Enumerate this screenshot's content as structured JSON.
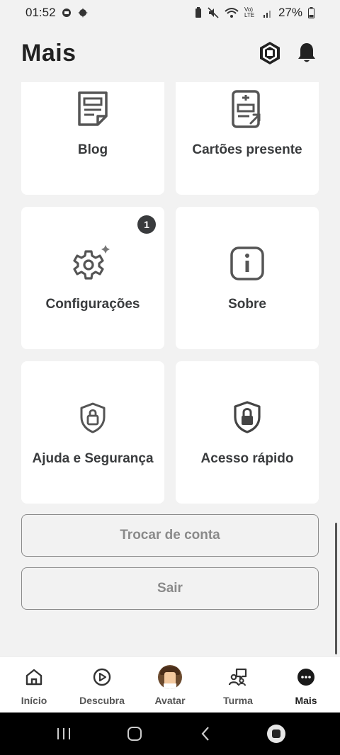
{
  "status_bar": {
    "time": "01:52",
    "battery": "27%",
    "network": "Vo) LTE"
  },
  "header": {
    "title": "Mais"
  },
  "tiles": [
    {
      "label": "Blog"
    },
    {
      "label": "Cartões presente"
    },
    {
      "label": "Configurações",
      "badge": "1"
    },
    {
      "label": "Sobre"
    },
    {
      "label": "Ajuda e Segurança"
    },
    {
      "label": "Acesso rápido"
    }
  ],
  "buttons": {
    "switch_account": "Trocar de conta",
    "logout": "Sair"
  },
  "bottom_nav": [
    {
      "label": "Início"
    },
    {
      "label": "Descubra"
    },
    {
      "label": "Avatar"
    },
    {
      "label": "Turma"
    },
    {
      "label": "Mais"
    }
  ],
  "colors": {
    "background": "#f2f2f2",
    "tile": "#ffffff",
    "text": "#393b3d",
    "muted": "#8a8a8a"
  }
}
